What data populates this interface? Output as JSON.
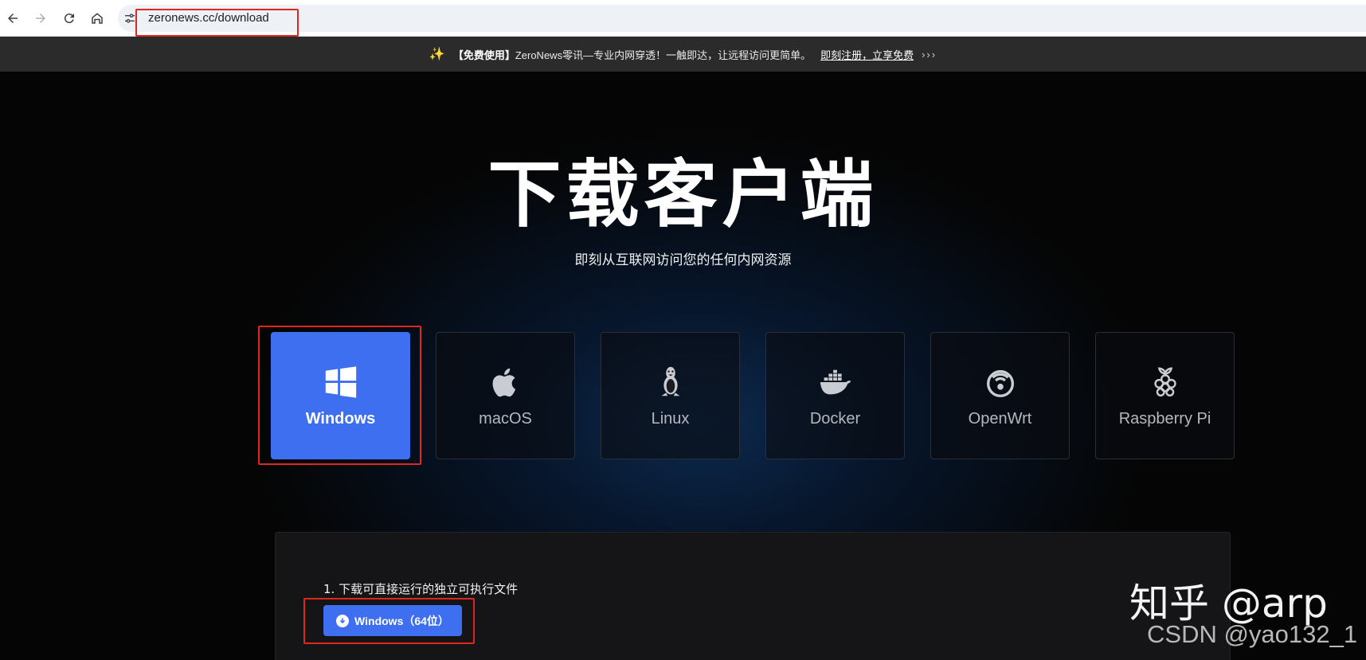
{
  "browser": {
    "url": "zeronews.cc/download",
    "back_icon": "arrow-left-icon",
    "forward_icon": "arrow-right-icon",
    "reload_icon": "reload-icon",
    "home_icon": "home-icon",
    "site_info_icon": "tune-icon"
  },
  "announcement": {
    "highlight": "【免费使用】",
    "text": "ZeroNews零讯—专业内网穿透！一触即达，让远程访问更简单。",
    "link": "即刻注册，立享免费",
    "chevrons": "›››",
    "icon": "sparkle-icon"
  },
  "hero": {
    "title": "下载客户端",
    "subtitle": "即刻从互联网访问您的任何内网资源"
  },
  "platforms": [
    {
      "label": "Windows",
      "icon": "windows-icon",
      "active": true
    },
    {
      "label": "macOS",
      "icon": "apple-icon",
      "active": false
    },
    {
      "label": "Linux",
      "icon": "linux-icon",
      "active": false
    },
    {
      "label": "Docker",
      "icon": "docker-icon",
      "active": false
    },
    {
      "label": "OpenWrt",
      "icon": "openwrt-icon",
      "active": false
    },
    {
      "label": "Raspberry Pi",
      "icon": "raspberry-pi-icon",
      "active": false
    }
  ],
  "download": {
    "step": "1. 下载可直接运行的独立可执行文件",
    "button": "Windows（64位）"
  },
  "watermarks": {
    "zhihu": "知乎 @arp",
    "csdn": "CSDN @yao132_1"
  },
  "colors": {
    "accent": "#3d6ff0",
    "highlight_box": "#e0261f",
    "background": "#050505"
  }
}
